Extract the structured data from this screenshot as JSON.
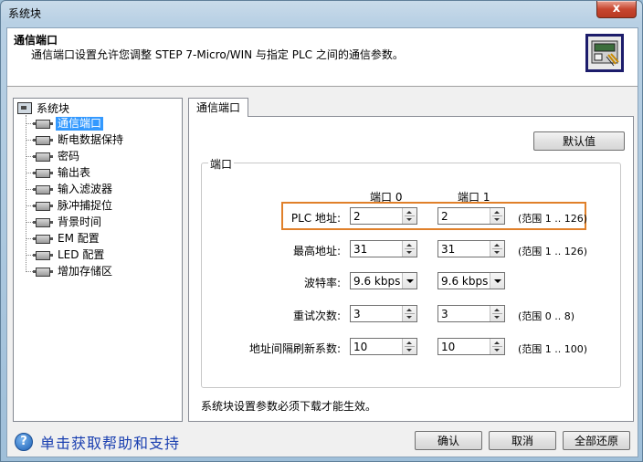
{
  "window": {
    "title": "系统块",
    "close_glyph": "x"
  },
  "header": {
    "title": "通信端口",
    "description": "通信端口设置允许您调整 STEP 7-Micro/WIN 与指定 PLC 之间的通信参数。"
  },
  "tree": {
    "root": "系统块",
    "items": [
      {
        "label": "通信端口",
        "selected": true
      },
      {
        "label": "断电数据保持"
      },
      {
        "label": "密码"
      },
      {
        "label": "输出表"
      },
      {
        "label": "输入滤波器"
      },
      {
        "label": "脉冲捕捉位"
      },
      {
        "label": "背景时间"
      },
      {
        "label": "EM 配置"
      },
      {
        "label": "LED 配置"
      },
      {
        "label": "增加存储区"
      }
    ]
  },
  "tab": {
    "label": "通信端口"
  },
  "panel": {
    "default_button": "默认值",
    "group_title": "端口",
    "port0_header": "端口 0",
    "port1_header": "端口 1",
    "rows": {
      "plc_address": {
        "label": "PLC 地址:",
        "port0": "2",
        "port1": "2",
        "range": "(范围 1 .. 126)"
      },
      "max_address": {
        "label": "最高地址:",
        "port0": "31",
        "port1": "31",
        "range": "(范围 1 .. 126)"
      },
      "baud_rate": {
        "label": "波特率:",
        "port0": "9.6 kbps",
        "port1": "9.6 kbps"
      },
      "retry_count": {
        "label": "重试次数:",
        "port0": "3",
        "port1": "3",
        "range": "(范围 0 .. 8)"
      },
      "gap_factor": {
        "label": "地址间隔刷新系数:",
        "port0": "10",
        "port1": "10",
        "range": "(范围 1 .. 100)"
      }
    },
    "note": "系统块设置参数必须下载才能生效。"
  },
  "footer": {
    "help_glyph": "?",
    "help_text": "单击获取帮助和支持",
    "ok": "确认",
    "cancel": "取消",
    "restore_all": "全部还原"
  },
  "colors": {
    "highlight": "#e0802a",
    "selection": "#3399ff",
    "help_text": "#1a3fb0"
  }
}
